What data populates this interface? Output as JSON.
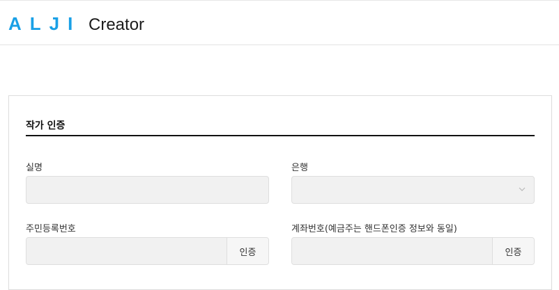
{
  "header": {
    "logo_mark": "ALJI",
    "logo_text": "Creator",
    "logo_color": "#1aa0e6"
  },
  "form": {
    "title": "작가 인증",
    "name_label": "실명",
    "bank_label": "은행",
    "rrn_label": "주민등록번호",
    "account_label": "계좌번호(예금주는 핸드폰인증 정보와 동일)",
    "verify_label": "인증",
    "account_verify_label": "인증"
  }
}
